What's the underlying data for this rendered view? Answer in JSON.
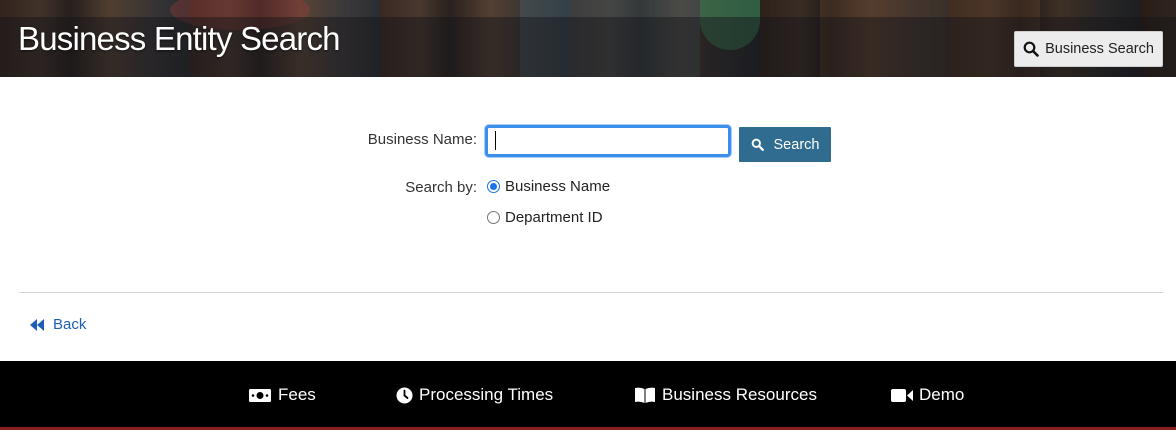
{
  "header": {
    "title": "Business Entity Search",
    "top_search_label": "Business Search"
  },
  "form": {
    "name_label": "Business Name:",
    "name_value": "",
    "search_button_label": "Search",
    "search_by_label": "Search by:",
    "options": [
      {
        "label": "Business Name",
        "selected": true
      },
      {
        "label": "Department ID",
        "selected": false
      }
    ]
  },
  "nav": {
    "back_label": "Back"
  },
  "footer": {
    "items": [
      {
        "label": "Fees",
        "icon": "money-icon"
      },
      {
        "label": "Processing Times",
        "icon": "clock-icon"
      },
      {
        "label": "Business Resources",
        "icon": "book-icon"
      },
      {
        "label": "Demo",
        "icon": "video-icon"
      }
    ]
  },
  "colors": {
    "primary_button": "#2f6c8f",
    "link": "#1d5fb8",
    "focus": "#3b8eea",
    "footer_bg": "#000000",
    "footer_accent": "#8b1e1e"
  }
}
